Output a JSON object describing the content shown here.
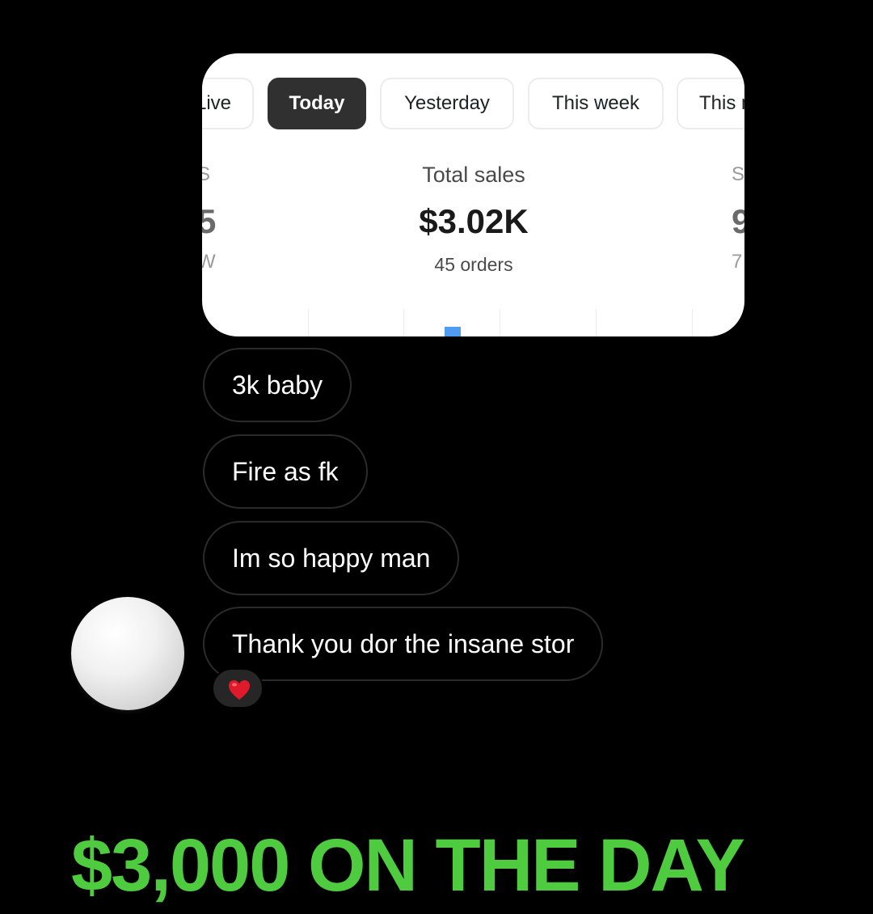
{
  "card": {
    "tabs": [
      {
        "label": "Live",
        "active": false
      },
      {
        "label": "Today",
        "active": true
      },
      {
        "label": "Yesterday",
        "active": false
      },
      {
        "label": "This week",
        "active": false
      },
      {
        "label": "This month",
        "active": false
      }
    ],
    "metric": {
      "label": "Total sales",
      "value": "$3.02K",
      "sub": "45 orders"
    },
    "left_clipped": {
      "label": "S",
      "value": "5",
      "sub": "W"
    },
    "right_clipped": {
      "label": "S",
      "value": "9",
      "sub": "7"
    },
    "colors": {
      "active_tab": "#303030",
      "chart_bar": "#4f9cf0"
    }
  },
  "chat": {
    "messages": [
      {
        "text": "3k baby"
      },
      {
        "text": "Fire as fk"
      },
      {
        "text": "Im so happy man"
      },
      {
        "text": "Thank you dor the insane stor"
      }
    ],
    "reaction": {
      "icon": "heart-icon",
      "color": "#e0192b"
    }
  },
  "caption": {
    "text": "$3,000 ON THE DAY",
    "color": "#4fcb3f"
  }
}
